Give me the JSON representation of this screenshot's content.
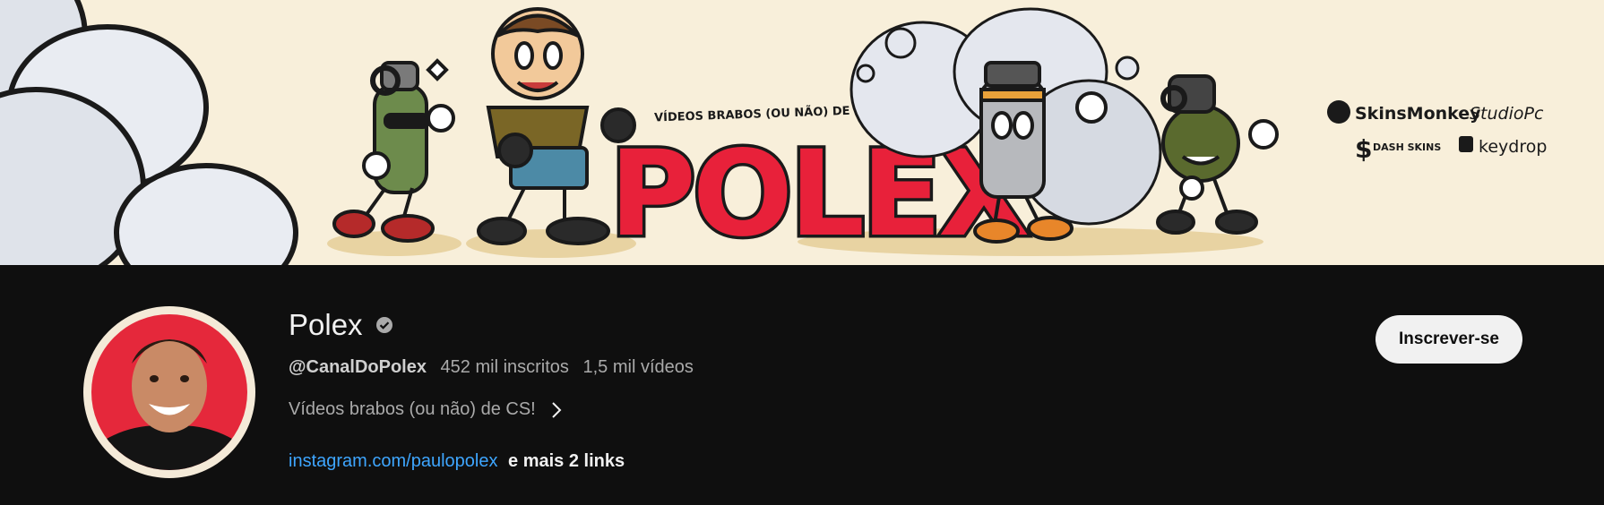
{
  "banner": {
    "tagline": "VÍDEOS BRABOS (OU NÃO) DE CS!",
    "logo_text": "POLEX",
    "sponsors": [
      "SkinsMonkey",
      "StudioPc",
      "DASH SKINS",
      "keydrop"
    ]
  },
  "channel": {
    "name": "Polex",
    "handle": "@CanalDoPolex",
    "subscribers": "452 mil inscritos",
    "videos": "1,5 mil vídeos",
    "description": "Vídeos brabos (ou não) de CS!",
    "link": "instagram.com/paulopolex",
    "more_links": "e mais 2 links"
  },
  "subscribe_button": {
    "label": "Inscrever-se"
  },
  "icons": {
    "verified": "verified-check-icon",
    "description_expand": "chevron-right-icon"
  },
  "colors": {
    "background": "#0f0f0f",
    "banner_bg": "#f8efda",
    "logo_red": "#e8213a",
    "link_blue": "#3ea6ff",
    "button_bg": "#f1f1f1"
  }
}
